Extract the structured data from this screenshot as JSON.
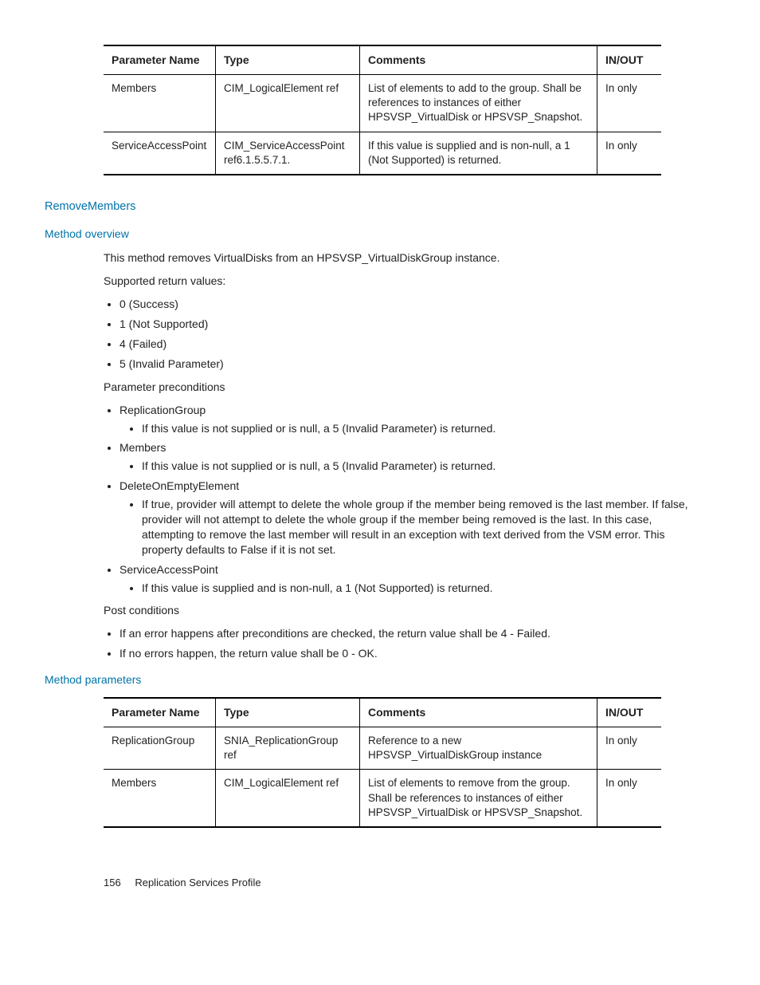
{
  "table1": {
    "headers": [
      "Parameter Name",
      "Type",
      "Comments",
      "IN/OUT"
    ],
    "rows": [
      {
        "name": "Members",
        "type": "CIM_LogicalElement ref",
        "comments": "List of elements to add to the group. Shall be references to instances of either HPSVSP_VirtualDisk or HPSVSP_Snapshot.",
        "inout": "In only"
      },
      {
        "name": "ServiceAccessPoint",
        "type": "CIM_ServiceAccessPoint ref6.1.5.5.7.1.",
        "comments": "If this value is supplied and is non-null, a 1 (Not Supported) is returned.",
        "inout": "In only"
      }
    ]
  },
  "section1": {
    "title": "RemoveMembers"
  },
  "section2": {
    "title": "Method overview",
    "intro": "This method removes VirtualDisks from an HPSVSP_VirtualDiskGroup instance.",
    "supported_label": "Supported return values:",
    "returns": [
      "0 (Success)",
      "1 (Not Supported)",
      "4 (Failed)",
      "5 (Invalid Parameter)"
    ],
    "pre_label": "Parameter preconditions",
    "pre": [
      {
        "name": "ReplicationGroup",
        "subs": [
          "If this value is not supplied or is null, a 5 (Invalid Parameter) is returned."
        ]
      },
      {
        "name": "Members",
        "subs": [
          "If this value is not supplied or is null, a 5 (Invalid Parameter) is returned."
        ]
      },
      {
        "name": "DeleteOnEmptyElement",
        "subs": [
          "If true, provider will attempt to delete the whole group if the member being removed is the last member. If false, provider will not attempt to delete the whole group if the member being removed is the last. In this case, attempting to remove the last member will result in an exception with text derived from the VSM error. This property defaults to False if it is not set."
        ]
      },
      {
        "name": "ServiceAccessPoint",
        "subs": [
          "If this value is supplied and is non-null, a 1 (Not Supported) is returned."
        ]
      }
    ],
    "post_label": "Post conditions",
    "post": [
      "If an error happens after preconditions are checked, the return value shall be 4 - Failed.",
      "If no errors happen, the return value shall be 0 - OK."
    ]
  },
  "section3": {
    "title": "Method parameters"
  },
  "table2": {
    "headers": [
      "Parameter Name",
      "Type",
      "Comments",
      "IN/OUT"
    ],
    "rows": [
      {
        "name": "ReplicationGroup",
        "type": "SNIA_ReplicationGroup ref",
        "comments": "Reference to a new HPSVSP_VirtualDiskGroup instance",
        "inout": "In only"
      },
      {
        "name": "Members",
        "type": "CIM_LogicalElement ref",
        "comments": "List of elements to remove from the group. Shall be references to instances of either HPSVSP_VirtualDisk or HPSVSP_Snapshot.",
        "inout": "In only"
      }
    ]
  },
  "footer": {
    "page": "156",
    "title": "Replication Services Profile"
  }
}
